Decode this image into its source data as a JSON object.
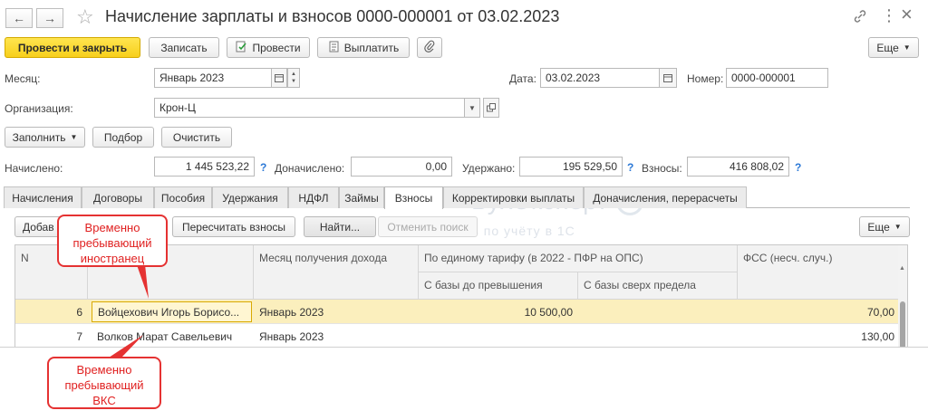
{
  "window": {
    "title": "Начисление зарплаты и взносов 0000-000001 от 03.02.2023",
    "nav_back": "←",
    "nav_forward": "→",
    "star": "☆",
    "link": "🔗",
    "menu": "⋮",
    "close": "×"
  },
  "toolbar": {
    "post_close": "Провести и закрыть",
    "save": "Записать",
    "post": "Провести",
    "pay": "Выплатить",
    "more": "Еще"
  },
  "form": {
    "month_label": "Месяц:",
    "month_value": "Январь 2023",
    "date_label": "Дата:",
    "date_value": "03.02.2023",
    "number_label": "Номер:",
    "number_value": "0000-000001",
    "org_label": "Организация:",
    "org_value": "Крон-Ц"
  },
  "actions": {
    "fill": "Заполнить",
    "select": "Подбор",
    "clear": "Очистить"
  },
  "totals": {
    "accrued_label": "Начислено:",
    "accrued_value": "1 445 523,22",
    "extra_label": "Доначислено:",
    "extra_value": "0,00",
    "withheld_label": "Удержано:",
    "withheld_value": "195 529,50",
    "contrib_label": "Взносы:",
    "contrib_value": "416 808,02",
    "help": "?"
  },
  "tabs": [
    {
      "label": "Начисления"
    },
    {
      "label": "Договоры"
    },
    {
      "label": "Пособия"
    },
    {
      "label": "Удержания"
    },
    {
      "label": "НДФЛ"
    },
    {
      "label": "Займы"
    },
    {
      "label": "Взносы"
    },
    {
      "label": "Корректировки выплаты"
    },
    {
      "label": "Доначисления, перерасчеты"
    }
  ],
  "subtoolbar": {
    "add": "Добав",
    "recalc": "Пересчитать взносы",
    "find": "Найти...",
    "cancel_search": "Отменить поиск",
    "more": "Еще"
  },
  "table": {
    "headers": {
      "n": "N",
      "month": "Месяц получения дохода",
      "tariff": "По единому тарифу (в 2022 - ПФР на ОПС)",
      "base_below": "С базы до превышения",
      "base_above": "С базы сверх предела",
      "fss": "ФСС (несч. случ.)"
    },
    "rows": [
      {
        "n": "6",
        "name": "Войцехович Игорь Борисо...",
        "month": "Январь 2023",
        "below": "10 500,00",
        "above": "",
        "fss": "70,00"
      },
      {
        "n": "7",
        "name": "Волков Марат Савельевич",
        "month": "Январь 2023",
        "below": "",
        "above": "",
        "fss": "130,00"
      }
    ]
  },
  "callouts": {
    "top": "Временно пребывающий иностранец",
    "bottom": "Временно пребывающий ВКС"
  },
  "watermark": {
    "brand": "БухЭксперт",
    "tagline": "База ответов по учёту в 1С"
  },
  "colors": {
    "accent_yellow": "#f7cf1c",
    "callout_red": "#e53232",
    "selected_row": "#fbefbd",
    "help_blue": "#2b78d6"
  }
}
